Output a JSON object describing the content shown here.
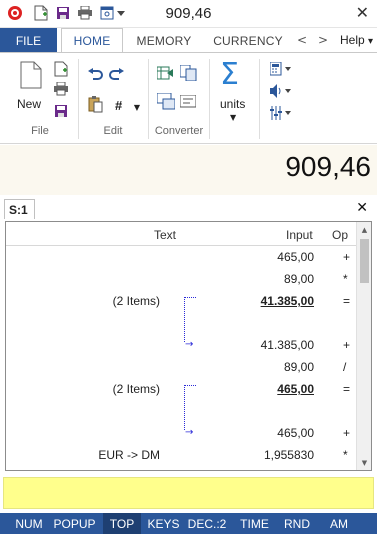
{
  "window": {
    "title": "909,46",
    "close_glyph": "✕"
  },
  "ribbon_tabs": {
    "file": "FILE",
    "home": "HOME",
    "memory": "MEMORY",
    "currency": "CURRENCY",
    "prev": "<",
    "next": ">",
    "help": "Help",
    "help_caret": "▾"
  },
  "ribbon": {
    "new_label": "New",
    "file_group": "File",
    "edit_group": "Edit",
    "hash_label": "#",
    "converter_group": "Converter",
    "units_label": "units",
    "sigma": "Σ"
  },
  "display": {
    "value": "909,46"
  },
  "sheet": {
    "tab_label": "S:1",
    "close_glyph": "✕"
  },
  "tape": {
    "columns": {
      "text": "Text",
      "input": "Input",
      "op": "Op"
    },
    "rows": [
      {
        "text": "",
        "input": "465,00",
        "op": "+",
        "bold": false
      },
      {
        "text": "",
        "input": "89,00",
        "op": "*",
        "bold": false
      },
      {
        "text": "(2 Items)",
        "input": "41.385,00",
        "op": "=",
        "bold": true
      },
      {
        "text": "",
        "input": "",
        "op": "",
        "bold": false
      },
      {
        "text": "",
        "input": "41.385,00",
        "op": "+",
        "bold": false
      },
      {
        "text": "",
        "input": "89,00",
        "op": "/",
        "bold": false
      },
      {
        "text": "(2 Items)",
        "input": "465,00",
        "op": "=",
        "bold": true
      },
      {
        "text": "",
        "input": "",
        "op": "",
        "bold": false
      },
      {
        "text": "",
        "input": "465,00",
        "op": "+",
        "bold": false
      },
      {
        "text": "EUR -> DM",
        "input": "1,955830",
        "op": "*",
        "bold": false
      }
    ]
  },
  "statusbar": {
    "items": [
      "NUM",
      "POPUP",
      "TOP",
      "KEYS",
      "DEC.:2",
      "TIME",
      "RND",
      "AM"
    ],
    "active": "TOP"
  },
  "colors": {
    "accent": "#2b579a",
    "display_bg": "#fbf8ef",
    "input_line": "#ffff8c",
    "bracket": "#2a2ad8"
  }
}
